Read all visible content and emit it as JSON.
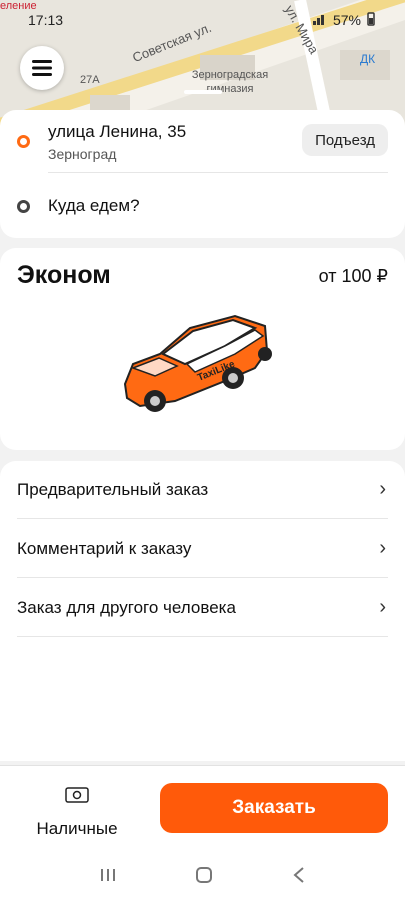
{
  "status_bar": {
    "time": "17:13",
    "battery": "57%",
    "signal": "4G"
  },
  "map": {
    "street1": "Советская ул.",
    "street2": "ул. Мира",
    "poi": "Зерноградская гимназия",
    "house": "27А",
    "dk": "ДК",
    "corner_label": "еление"
  },
  "route": {
    "from_address": "улица Ленина, 35",
    "from_city": "Зерноград",
    "entrance_label": "Подъезд",
    "to_placeholder": "Куда едем?"
  },
  "tariff": {
    "name": "Эконом",
    "price": "от 100 ₽",
    "car_brand": "TaxiLike"
  },
  "options": [
    {
      "label": "Предварительный заказ"
    },
    {
      "label": "Комментарий к заказу"
    },
    {
      "label": "Заказ для другого человека"
    }
  ],
  "payment": {
    "label": "Наличные",
    "icon": "cash-icon"
  },
  "order_button": {
    "label": "Заказать"
  },
  "colors": {
    "accent": "#ff5a0a",
    "from_dot": "#ff6a13"
  }
}
